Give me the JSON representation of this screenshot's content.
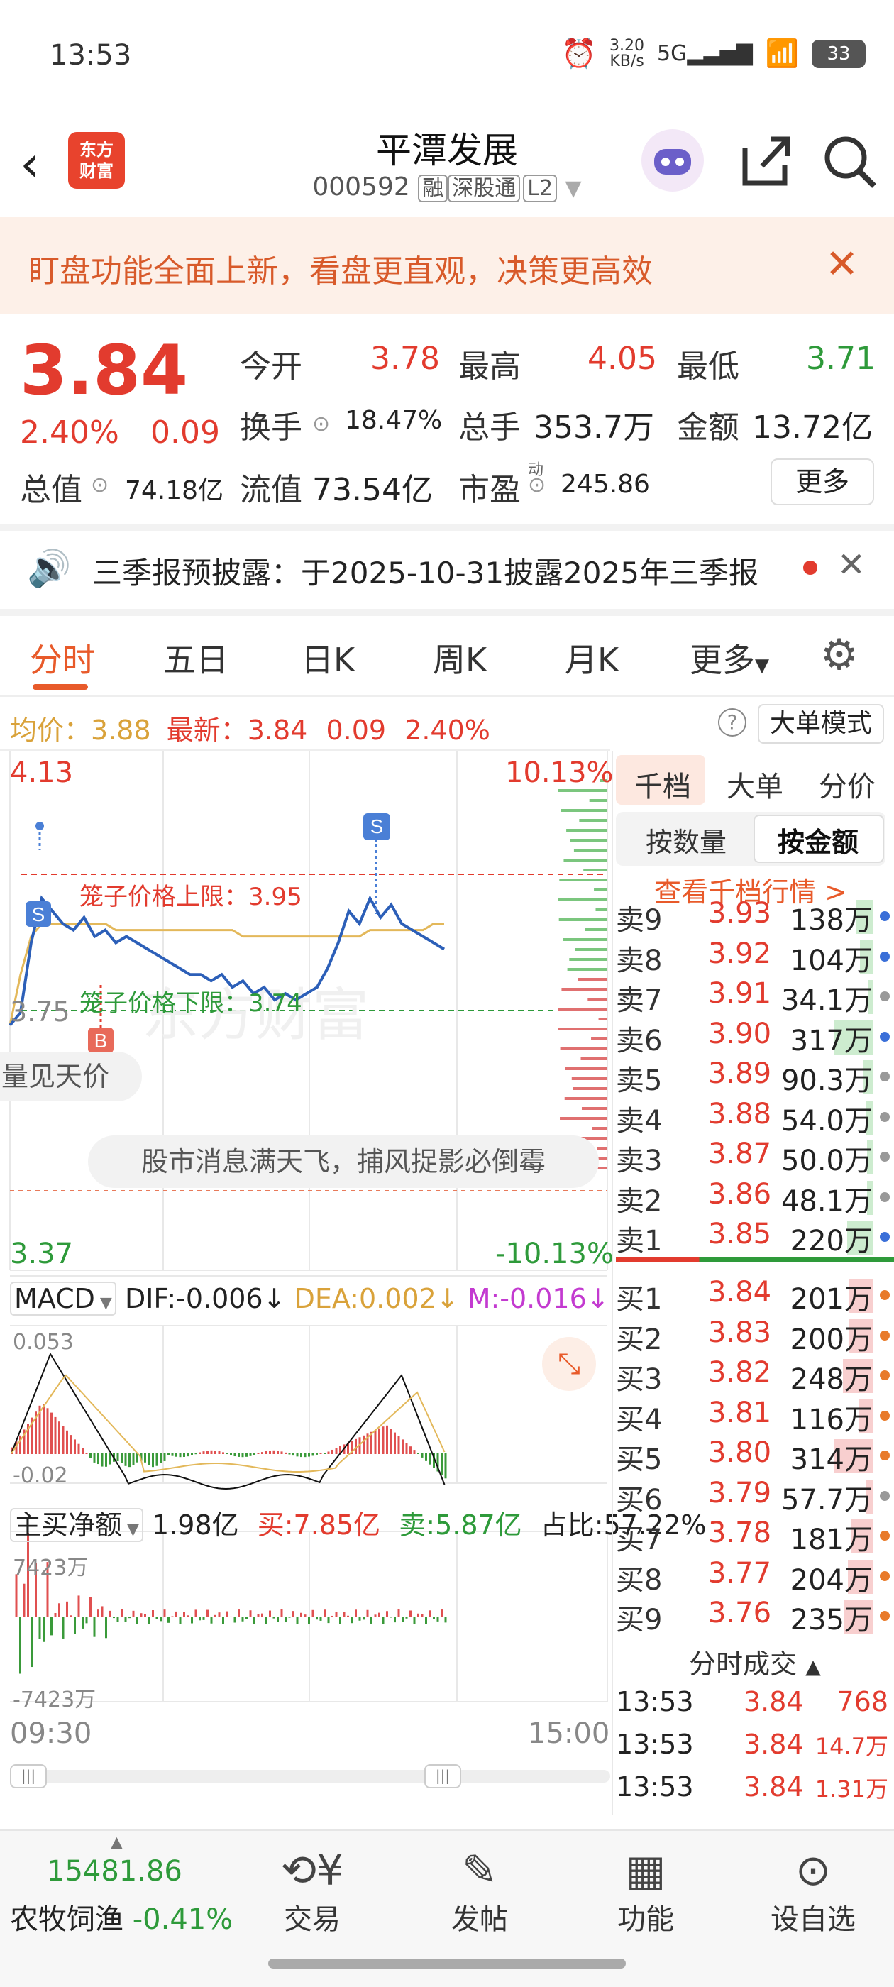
{
  "status": {
    "time": "13:53",
    "net_speed": "3.20\nKB/s",
    "net_type": "5G",
    "battery": "33"
  },
  "header": {
    "logo": "东方\n财富",
    "title": "平潭发展",
    "code": "000592",
    "tags": [
      "融",
      "深股通",
      "L2"
    ]
  },
  "banner": {
    "text": "盯盘功能全面上新，看盘更直观，决策更高效"
  },
  "quote": {
    "price": "3.84",
    "change_pct": "2.40%",
    "change": "0.09",
    "open_label": "今开",
    "open": "3.78",
    "high_label": "最高",
    "high": "4.05",
    "low_label": "最低",
    "low": "3.71",
    "turnover_label": "换手",
    "turnover": "18.47%",
    "volume_label": "总手",
    "volume": "353.7万",
    "amount_label": "金额",
    "amount": "13.72亿",
    "mktcap_label": "总值",
    "mktcap": "74.18亿",
    "float_label": "流值",
    "float": "73.54亿",
    "pe_label": "市盈",
    "pe_sup": "动",
    "pe": "245.86",
    "more": "更多"
  },
  "news": {
    "text": "三季报预披露：于2025-10-31披露2025年三季报"
  },
  "tabs": [
    "分时",
    "五日",
    "日K",
    "周K",
    "月K",
    "更多"
  ],
  "avgline": {
    "avg_label": "均价：",
    "avg": "3.88",
    "last_label": "最新：",
    "last": "3.84",
    "chg": "0.09",
    "pct": "2.40%",
    "mode_btn": "大单模式"
  },
  "chart": {
    "y_high": "4.13",
    "y_high_pct": "10.13%",
    "y_low": "3.37",
    "y_low_pct": "-10.13%",
    "y_mid_left": "3.75",
    "cage_upper": "笼子价格上限：3.95",
    "cage_lower": "笼子价格下限：3.74",
    "watermark": "东方财富",
    "bubble1": "量见天价",
    "bubble2": "股市消息满天飞，捕风捉影必倒霉",
    "marker_s": "S",
    "marker_b": "B",
    "time_start": "09:30",
    "time_end": "15:00",
    "price_series": [
      3.72,
      3.74,
      3.85,
      3.92,
      3.9,
      3.88,
      3.87,
      3.89,
      3.86,
      3.87,
      3.85,
      3.86,
      3.85,
      3.84,
      3.83,
      3.82,
      3.81,
      3.8,
      3.8,
      3.79,
      3.8,
      3.78,
      3.79,
      3.77,
      3.78,
      3.76,
      3.77,
      3.76,
      3.77,
      3.78,
      3.81,
      3.85,
      3.9,
      3.88,
      3.92,
      3.89,
      3.91,
      3.88,
      3.87,
      3.86,
      3.85,
      3.84
    ],
    "avg_series": [
      3.72,
      3.8,
      3.86,
      3.88,
      3.88,
      3.88,
      3.88,
      3.88,
      3.88,
      3.88,
      3.87,
      3.87,
      3.87,
      3.87,
      3.87,
      3.87,
      3.87,
      3.87,
      3.87,
      3.87,
      3.87,
      3.87,
      3.86,
      3.86,
      3.86,
      3.86,
      3.86,
      3.86,
      3.86,
      3.86,
      3.86,
      3.86,
      3.86,
      3.86,
      3.87,
      3.87,
      3.87,
      3.87,
      3.87,
      3.87,
      3.88,
      3.88
    ]
  },
  "macd": {
    "name": "MACD",
    "dif": "DIF:-0.006",
    "dea": "DEA:0.002",
    "m": "M:-0.016",
    "top": "0.053",
    "bottom": "-0.02"
  },
  "flow": {
    "name": "主买净额",
    "net": "1.98亿",
    "buy": "买:7.85亿",
    "sell": "卖:5.87亿",
    "ratio": "占比:57.22%",
    "top": "7423万",
    "bottom": "-7423万"
  },
  "rp": {
    "tab1": "千档",
    "tab2": "大单",
    "tab3": "分价",
    "sub1": "按数量",
    "sub2": "按金额",
    "link": "查看千档行情 >",
    "asks": [
      {
        "lbl": "卖9",
        "p": "3.93",
        "v": "138万",
        "w": 0.2,
        "dot": "#3a6fd8"
      },
      {
        "lbl": "卖8",
        "p": "3.92",
        "v": "104万",
        "w": 0.15,
        "dot": "#3a6fd8"
      },
      {
        "lbl": "卖7",
        "p": "3.91",
        "v": "34.1万",
        "w": 0.05,
        "dot": "#999"
      },
      {
        "lbl": "卖6",
        "p": "3.90",
        "v": "317万",
        "w": 0.45,
        "dot": "#3a6fd8"
      },
      {
        "lbl": "卖5",
        "p": "3.89",
        "v": "90.3万",
        "w": 0.12,
        "dot": "#999"
      },
      {
        "lbl": "卖4",
        "p": "3.88",
        "v": "54.0万",
        "w": 0.08,
        "dot": "#999"
      },
      {
        "lbl": "卖3",
        "p": "3.87",
        "v": "50.0万",
        "w": 0.07,
        "dot": "#999"
      },
      {
        "lbl": "卖2",
        "p": "3.86",
        "v": "48.1万",
        "w": 0.07,
        "dot": "#999"
      },
      {
        "lbl": "卖1",
        "p": "3.85",
        "v": "220万",
        "w": 0.3,
        "dot": "#3a6fd8"
      }
    ],
    "bids": [
      {
        "lbl": "买1",
        "p": "3.84",
        "v": "201万",
        "w": 0.28,
        "dot": "#e87a2a"
      },
      {
        "lbl": "买2",
        "p": "3.83",
        "v": "200万",
        "w": 0.28,
        "dot": "#e87a2a"
      },
      {
        "lbl": "买3",
        "p": "3.82",
        "v": "248万",
        "w": 0.35,
        "dot": "#e87a2a"
      },
      {
        "lbl": "买4",
        "p": "3.81",
        "v": "116万",
        "w": 0.17,
        "dot": "#e87a2a"
      },
      {
        "lbl": "买5",
        "p": "3.80",
        "v": "314万",
        "w": 0.45,
        "dot": "#e87a2a"
      },
      {
        "lbl": "买6",
        "p": "3.79",
        "v": "57.7万",
        "w": 0.08,
        "dot": "#999"
      },
      {
        "lbl": "买7",
        "p": "3.78",
        "v": "181万",
        "w": 0.26,
        "dot": "#e87a2a"
      },
      {
        "lbl": "买8",
        "p": "3.77",
        "v": "204万",
        "w": 0.29,
        "dot": "#e87a2a"
      },
      {
        "lbl": "买9",
        "p": "3.76",
        "v": "235万",
        "w": 0.33,
        "dot": "#e87a2a"
      }
    ],
    "trades_title": "分时成交",
    "trades": [
      {
        "t": "13:53",
        "p": "3.84",
        "v": "768"
      },
      {
        "t": "13:53",
        "p": "3.84",
        "v": "14.7万"
      },
      {
        "t": "13:53",
        "p": "3.84",
        "v": "1.31万"
      }
    ]
  },
  "bottom": {
    "index_value": "15481.86",
    "index_name": "农牧饲渔",
    "index_chg": "-0.41%",
    "items": [
      "交易",
      "发帖",
      "功能",
      "设自选"
    ]
  }
}
